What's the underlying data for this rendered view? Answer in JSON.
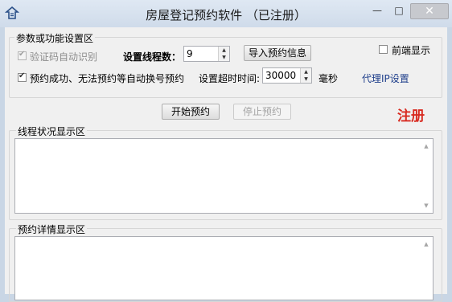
{
  "window": {
    "title": "房屋登记预约软件 （已注册）",
    "minimize_glyph": "—",
    "maximize_glyph": "□",
    "close_glyph": "✕"
  },
  "settings": {
    "legend": "参数或功能设置区",
    "captcha_checkbox": {
      "label": "验证码自动识别",
      "checked": true,
      "disabled": true
    },
    "thread_count_label": "设置线程数：",
    "thread_count_value": "9",
    "import_button": "导入预约信息",
    "front_display_checkbox": {
      "label": "前端显示",
      "checked": false
    },
    "auto_switch_checkbox": {
      "label": "预约成功、无法预约等自动换号预约",
      "checked": true
    },
    "timeout_label": "设置超时时间:",
    "timeout_value": "30000",
    "timeout_unit": "毫秒",
    "proxy_link": "代理IP设置"
  },
  "actions": {
    "start_button": "开始预约",
    "stop_button": "停止预约",
    "register_label": "注册"
  },
  "thread_status": {
    "legend": "线程状况显示区",
    "content": ""
  },
  "booking_detail": {
    "legend": "预约详情显示区",
    "content": ""
  },
  "colors": {
    "register": "#d82a20",
    "link": "#1d3d8a",
    "window_frame": "#c9d6e5"
  }
}
